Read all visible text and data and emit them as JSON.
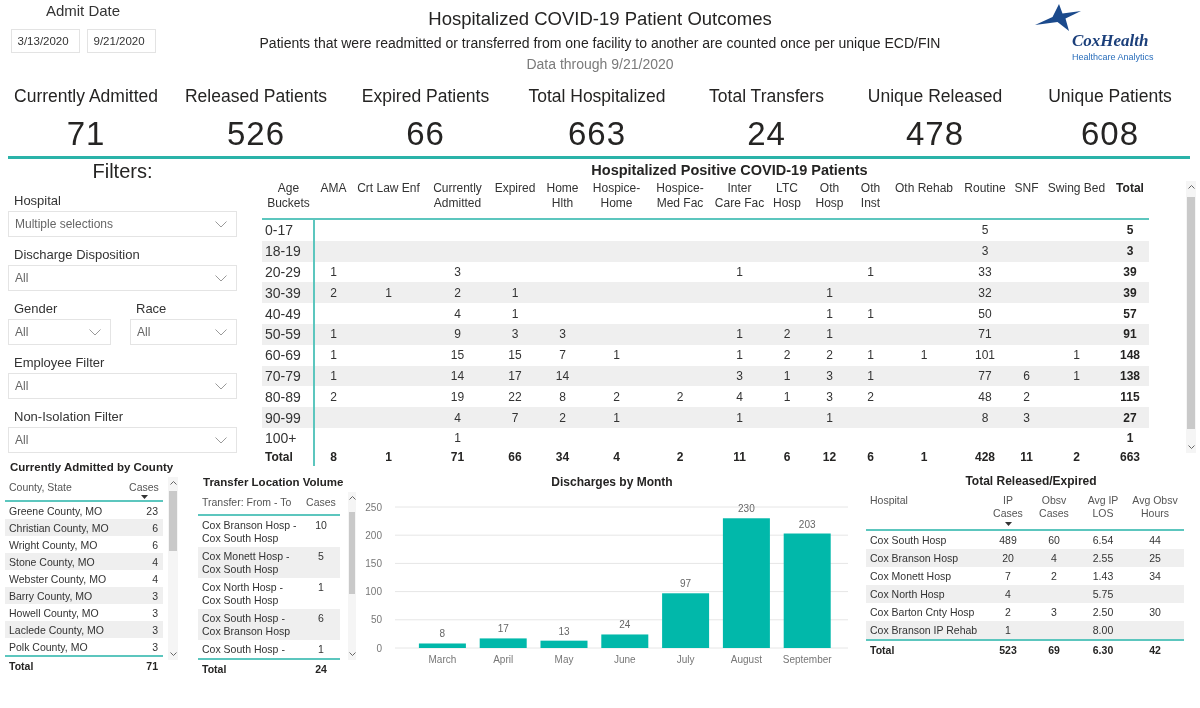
{
  "date_filter": {
    "label": "Admit Date",
    "start": "3/13/2020",
    "end": "9/21/2020"
  },
  "header": {
    "title": "Hospitalized COVID-19 Patient Outcomes",
    "subtitle": "Patients that were readmitted or transferred from one facility to another are counted once per unique ECD/FIN",
    "data_through": "Data through 9/21/2020"
  },
  "logo": {
    "name": "CoxHealth",
    "tagline": "Healthcare Analytics"
  },
  "kpis": [
    {
      "label": "Currently Admitted",
      "value": "71"
    },
    {
      "label": "Released Patients",
      "value": "526"
    },
    {
      "label": "Expired Patients",
      "value": "66"
    },
    {
      "label": "Total Hospitalized",
      "value": "663"
    },
    {
      "label": "Total Transfers",
      "value": "24"
    },
    {
      "label": "Unique Released",
      "value": "478"
    },
    {
      "label": "Unique Patients",
      "value": "608"
    }
  ],
  "filters": {
    "title": "Filters:",
    "items": [
      {
        "kind": "wide",
        "label": "Hospital",
        "value": "Multiple selections"
      },
      {
        "kind": "wide",
        "label": "Discharge Disposition",
        "value": "All"
      },
      {
        "kind": "half",
        "label": "Gender",
        "value": "All"
      },
      {
        "kind": "half",
        "label": "Race",
        "value": "All"
      },
      {
        "kind": "wide",
        "label": "Employee Filter",
        "value": "All"
      },
      {
        "kind": "wide",
        "label": "Non-Isolation Filter",
        "value": "All"
      }
    ]
  },
  "age_table": {
    "title": "Hospitalized Positive COVID-19 Patients",
    "columns": [
      "Age Buckets",
      "AMA",
      "Crt Law Enf",
      "Currently Admitted",
      "Expired",
      "Home Hlth",
      "Hospice-Home",
      "Hospice-Med Fac",
      "Inter Care Fac",
      "LTC Hosp",
      "Oth Hosp",
      "Oth Inst",
      "Oth Rehab",
      "Routine",
      "SNF",
      "Swing Bed",
      "Total"
    ],
    "rows": [
      {
        "label": "0-17",
        "routine": "5",
        "total": "5"
      },
      {
        "label": "18-19",
        "routine": "3",
        "total": "3"
      },
      {
        "label": "20-29",
        "ama": "1",
        "currently_admitted": "3",
        "inter_care_fac": "1",
        "oth_inst": "1",
        "routine": "33",
        "total": "39"
      },
      {
        "label": "30-39",
        "ama": "2",
        "crt_law_enf": "1",
        "currently_admitted": "2",
        "expired": "1",
        "oth_hosp": "1",
        "routine": "32",
        "total": "39"
      },
      {
        "label": "40-49",
        "currently_admitted": "4",
        "expired": "1",
        "oth_hosp": "1",
        "oth_inst": "1",
        "routine": "50",
        "total": "57"
      },
      {
        "label": "50-59",
        "ama": "1",
        "currently_admitted": "9",
        "expired": "3",
        "home_hlth": "3",
        "inter_care_fac": "1",
        "ltc_hosp": "2",
        "oth_hosp": "1",
        "routine": "71",
        "total": "91"
      },
      {
        "label": "60-69",
        "ama": "1",
        "currently_admitted": "15",
        "expired": "15",
        "home_hlth": "7",
        "hospice_home": "1",
        "inter_care_fac": "1",
        "ltc_hosp": "2",
        "oth_hosp": "2",
        "oth_inst": "1",
        "oth_rehab": "1",
        "routine": "101",
        "swing_bed": "1",
        "total": "148"
      },
      {
        "label": "70-79",
        "ama": "1",
        "currently_admitted": "14",
        "expired": "17",
        "home_hlth": "14",
        "inter_care_fac": "3",
        "ltc_hosp": "1",
        "oth_hosp": "3",
        "oth_inst": "1",
        "routine": "77",
        "snf": "6",
        "swing_bed": "1",
        "total": "138"
      },
      {
        "label": "80-89",
        "ama": "2",
        "currently_admitted": "19",
        "expired": "22",
        "home_hlth": "8",
        "hospice_home": "2",
        "hospice_med_fac": "2",
        "inter_care_fac": "4",
        "ltc_hosp": "1",
        "oth_hosp": "3",
        "oth_inst": "2",
        "routine": "48",
        "snf": "2",
        "total": "115"
      },
      {
        "label": "90-99",
        "currently_admitted": "4",
        "expired": "7",
        "home_hlth": "2",
        "hospice_home": "1",
        "inter_care_fac": "1",
        "oth_hosp": "1",
        "routine": "8",
        "snf": "3",
        "total": "27"
      },
      {
        "label": "100+",
        "currently_admitted": "1",
        "total": "1"
      }
    ],
    "total_row": {
      "label": "Total",
      "ama": "8",
      "crt_law_enf": "1",
      "currently_admitted": "71",
      "expired": "66",
      "home_hlth": "34",
      "hospice_home": "4",
      "hospice_med_fac": "2",
      "inter_care_fac": "11",
      "ltc_hosp": "6",
      "oth_hosp": "12",
      "oth_inst": "6",
      "oth_rehab": "1",
      "routine": "428",
      "snf": "11",
      "swing_bed": "2",
      "total": "663"
    }
  },
  "county_table": {
    "title": "Currently Admitted by County",
    "columns": [
      {
        "label": "County, State",
        "sorted": false
      },
      {
        "label": "Cases",
        "sorted": true
      }
    ],
    "rows": [
      {
        "county": "Greene County, MO",
        "cases": "23"
      },
      {
        "county": "Christian County, MO",
        "cases": "6"
      },
      {
        "county": "Wright County, MO",
        "cases": "6"
      },
      {
        "county": "Stone County, MO",
        "cases": "4"
      },
      {
        "county": "Webster County, MO",
        "cases": "4"
      },
      {
        "county": "Barry County, MO",
        "cases": "3"
      },
      {
        "county": "Howell County, MO",
        "cases": "3"
      },
      {
        "county": "Laclede County, MO",
        "cases": "3"
      },
      {
        "county": "Polk County, MO",
        "cases": "3"
      }
    ],
    "total": {
      "label": "Total",
      "cases": "71"
    }
  },
  "transfer_table": {
    "title": "Transfer Location Volume",
    "columns": [
      {
        "label": "Transfer: From - To",
        "sorted": false
      },
      {
        "label": "Cases",
        "sorted": false
      }
    ],
    "rows": [
      {
        "route": "Cox Branson Hosp - Cox South Hosp",
        "cases": "10"
      },
      {
        "route": "Cox Monett Hosp - Cox South Hosp",
        "cases": "5"
      },
      {
        "route": "Cox North Hosp - Cox South Hosp",
        "cases": "1"
      },
      {
        "route": "Cox South Hosp - Cox Branson Hosp",
        "cases": "6"
      },
      {
        "route": "Cox South Hosp -",
        "cases": "1"
      }
    ],
    "total": {
      "label": "Total",
      "cases": "24"
    }
  },
  "discharges_chart": {
    "chart_data": {
      "type": "bar",
      "title": "Discharges by Month",
      "categories": [
        "March",
        "April",
        "May",
        "June",
        "July",
        "August",
        "September"
      ],
      "values": [
        8,
        17,
        13,
        24,
        97,
        230,
        203
      ],
      "ylim": [
        0,
        250
      ],
      "yticks": [
        0,
        50,
        100,
        150,
        200,
        250
      ],
      "grid": true,
      "data_labels": true
    }
  },
  "released_table": {
    "title": "Total Released/Expired",
    "columns": [
      {
        "label": "Hospital",
        "sorted": false
      },
      {
        "label": "IP Cases",
        "sorted": true
      },
      {
        "label": "Obsv Cases",
        "sorted": false
      },
      {
        "label": "Avg IP LOS",
        "sorted": false
      },
      {
        "label": "Avg Obsv Hours",
        "sorted": false
      }
    ],
    "rows": [
      {
        "hospital": "Cox South Hosp",
        "ip_cases": "489",
        "obsv_cases": "60",
        "avg_ip_los": "6.54",
        "avg_obsv_hours": "44"
      },
      {
        "hospital": "Cox Branson Hosp",
        "ip_cases": "20",
        "obsv_cases": "4",
        "avg_ip_los": "2.55",
        "avg_obsv_hours": "25"
      },
      {
        "hospital": "Cox Monett Hosp",
        "ip_cases": "7",
        "obsv_cases": "2",
        "avg_ip_los": "1.43",
        "avg_obsv_hours": "34"
      },
      {
        "hospital": "Cox North Hosp",
        "ip_cases": "4",
        "avg_ip_los": "5.75"
      },
      {
        "hospital": "Cox Barton Cnty Hosp",
        "ip_cases": "2",
        "obsv_cases": "3",
        "avg_ip_los": "2.50",
        "avg_obsv_hours": "30"
      },
      {
        "hospital": "Cox Branson IP Rehab",
        "ip_cases": "1",
        "avg_ip_los": "8.00"
      }
    ],
    "total": {
      "label": "Total",
      "ip_cases": "523",
      "obsv_cases": "69",
      "avg_ip_los": "6.30",
      "avg_obsv_hours": "42"
    }
  }
}
